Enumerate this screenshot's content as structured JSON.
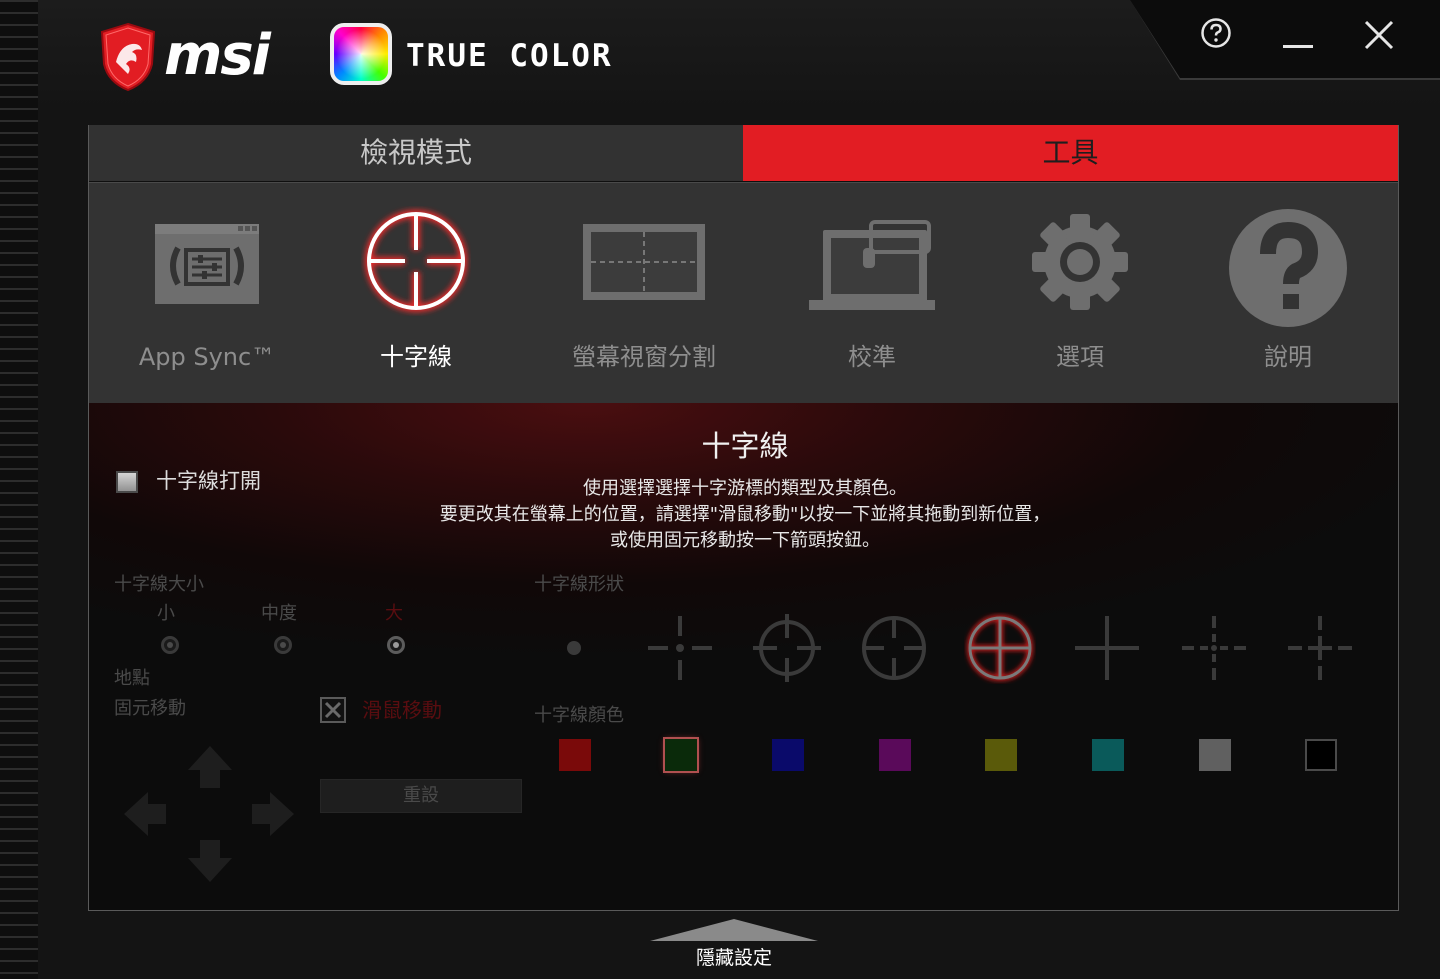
{
  "app": {
    "brand": "msi",
    "product": "TRUE COLOR"
  },
  "window_controls": {
    "help_icon": "question-circle-icon",
    "minimize_icon": "minimize-icon",
    "close_icon": "close-icon"
  },
  "tabs": [
    {
      "label": "檢視模式",
      "active": false
    },
    {
      "label": "工具",
      "active": true
    }
  ],
  "tools": [
    {
      "label": "App Sync™",
      "icon": "app-sync-icon",
      "active": false
    },
    {
      "label": "十字線",
      "icon": "crosshair-icon",
      "active": true
    },
    {
      "label": "螢幕視窗分割",
      "icon": "screen-split-icon",
      "active": false
    },
    {
      "label": "校準",
      "icon": "calibration-icon",
      "active": false
    },
    {
      "label": "選項",
      "icon": "gear-icon",
      "active": false
    },
    {
      "label": "說明",
      "icon": "help-icon",
      "active": false
    }
  ],
  "crosshair": {
    "title": "十字線",
    "description": [
      "使用選擇選擇十字游標的類型及其顏色。",
      "要更改其在螢幕上的位置，請選擇\"滑鼠移動\"以按一下並將其拖動到新位置，",
      "或使用固元移動按一下箭頭按鈕。"
    ],
    "enable_label": "十字線打開",
    "size": {
      "label": "十字線大小",
      "options": [
        "小",
        "中度",
        "大"
      ],
      "selected": "大"
    },
    "location": {
      "label": "地點",
      "fixed_move_label": "固元移動",
      "mouse_move_label": "滑鼠移動",
      "reset_label": "重設"
    },
    "shape": {
      "label": "十字線形狀",
      "options": [
        "dot-crosshair-icon",
        "gap-cross-dot-icon",
        "circle-cross-icon",
        "circle-gap-icon",
        "circle-cross-full-icon",
        "plain-cross-icon",
        "dashed-cross-dot-icon",
        "dashed-cross-icon"
      ],
      "selected_index": 4
    },
    "color": {
      "label": "十字線顏色",
      "options": [
        "#7a0a0a",
        "#0a2a0a",
        "#0a0a6a",
        "#5a0a5a",
        "#5a5a0a",
        "#0a5a5a",
        "#606060",
        "#000000"
      ],
      "selected_index": 1
    }
  },
  "footer": {
    "hide_settings_label": "隱藏設定"
  }
}
